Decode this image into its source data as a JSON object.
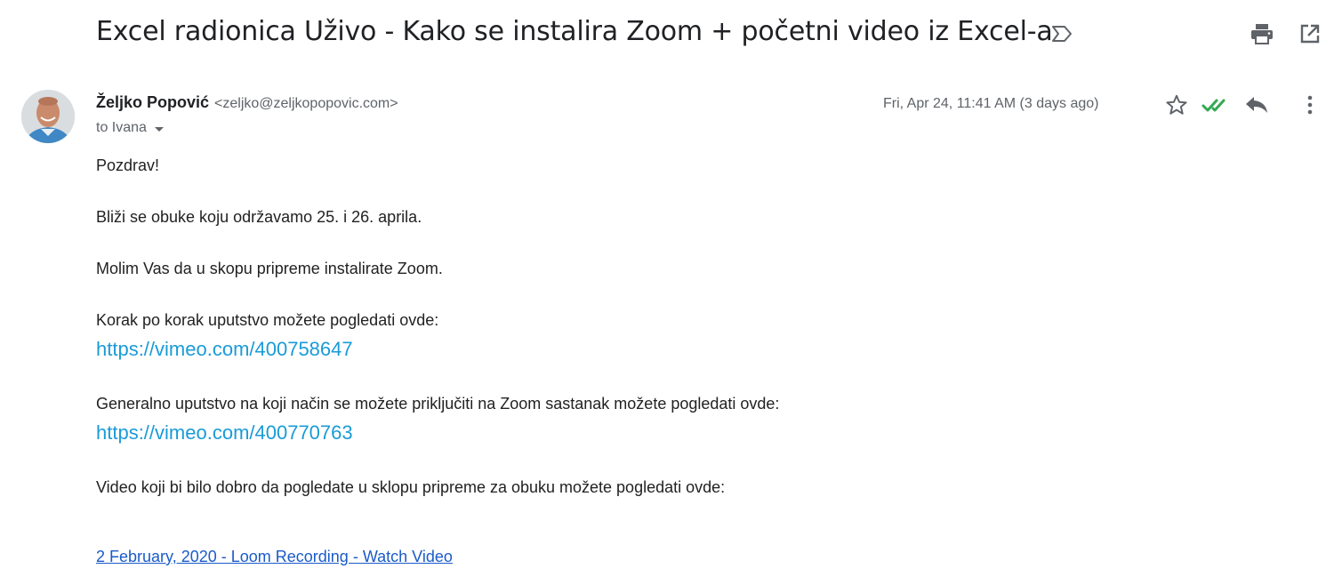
{
  "email": {
    "subject": "Excel radionica Uživo - Kako se instalira Zoom + početni video iz Excel-a",
    "sender_name": "Željko Popović",
    "sender_email": "<zeljko@zeljkopopovic.com>",
    "recipient": "to Ivana",
    "date": "Fri, Apr 24, 11:41 AM (3 days ago)",
    "body": {
      "greeting": "Pozdrav!",
      "p1": "Bliži se obuke koju održavamo 25. i 26. aprila.",
      "p2": "Molim Vas da u skopu pripreme instalirate Zoom.",
      "p3": "Korak po korak uputstvo možete pogledati ovde:",
      "link1": "https://vimeo.com/400758647",
      "p4": "Generalno uputstvo na koji način se možete priključiti na Zoom sastanak možete pogledati ovde:",
      "link2": "https://vimeo.com/400770763",
      "p5": "Video koji bi bilo dobro da pogledate u sklopu pripreme za obuku možete pogledati ovde:",
      "loom_link": "2 February, 2020 - Loom Recording - Watch Video"
    }
  },
  "icons": {
    "important": "label-important-outline-icon",
    "print": "print-icon",
    "new_window": "open-in-new-icon",
    "star": "star-outline-icon",
    "read_receipt": "double-check-icon",
    "reply": "reply-icon",
    "more": "more-vertical-icon"
  },
  "colors": {
    "link": "#1a9bd7",
    "loom_link": "#1a5bc9",
    "check": "#34a853",
    "icon_gray": "#5f6368"
  }
}
